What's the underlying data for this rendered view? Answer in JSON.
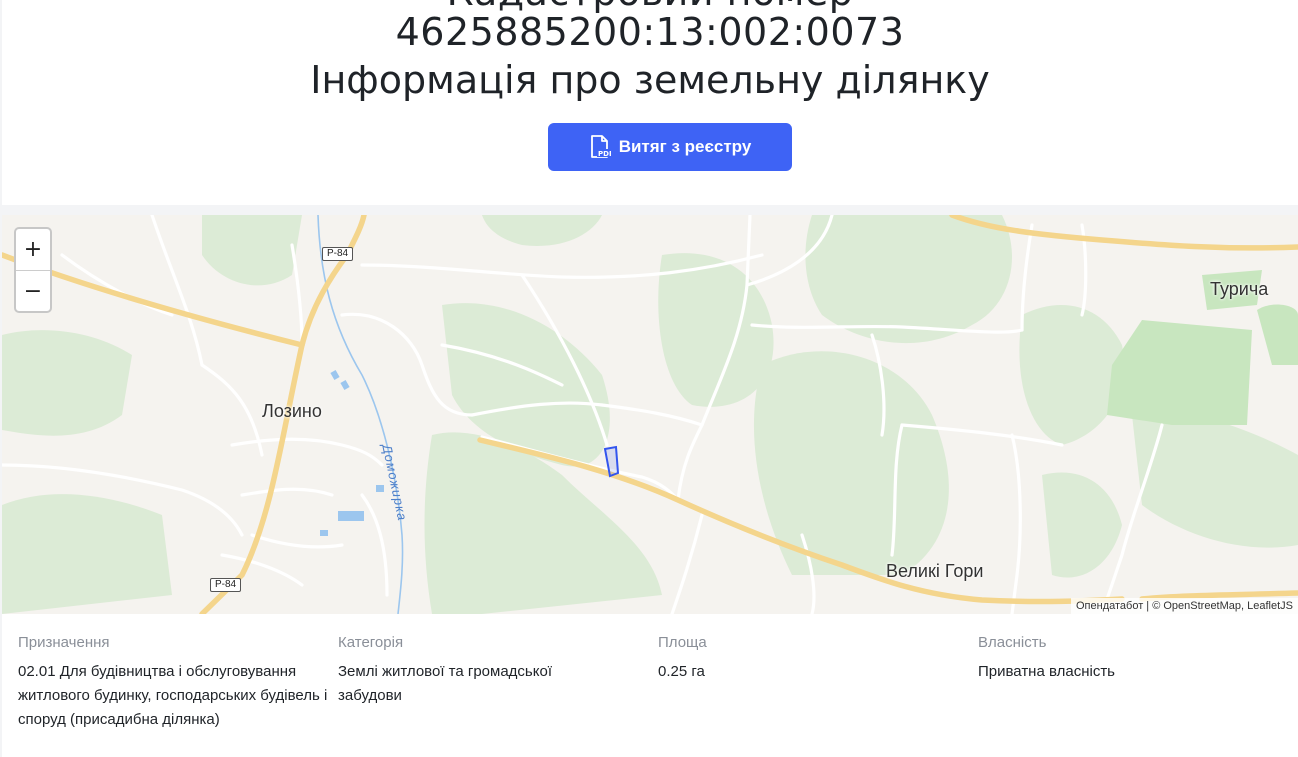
{
  "header": {
    "title_cut": "Кадастровий номер",
    "cadastral_number": "4625885200:13:002:0073",
    "subtitle": "Інформація про земельну ділянку",
    "pdf_button_label": "Витяг з реєстру",
    "pdf_icon_text": "PDF"
  },
  "map": {
    "zoom_in": "+",
    "zoom_out": "−",
    "places": {
      "lozyno": "Лозино",
      "turycha": "Турича",
      "velyki_hory": "Великі Гори"
    },
    "road_labels": [
      "Р-84",
      "Р-84"
    ],
    "river_label": "Доможирка",
    "attribution": "Опендатабот | © OpenStreetMap, LeafletJS"
  },
  "info": {
    "purpose": {
      "label": "Призначення",
      "value": "02.01 Для будівництва і обслуговування житлового будинку, господарських будівель і споруд (присадибна ділянка)"
    },
    "category": {
      "label": "Категорія",
      "value": "Землі житлової та громадської забудови"
    },
    "area": {
      "label": "Площа",
      "value": "0.25 га"
    },
    "ownership": {
      "label": "Власність",
      "value": "Приватна власність"
    }
  },
  "colors": {
    "accent": "#3e63f5",
    "parcel": "#3355ee",
    "forest": "#dcebd6",
    "meadow": "#c8e6bf",
    "road_major": "#f6d98a",
    "water": "#9cc6ee"
  }
}
